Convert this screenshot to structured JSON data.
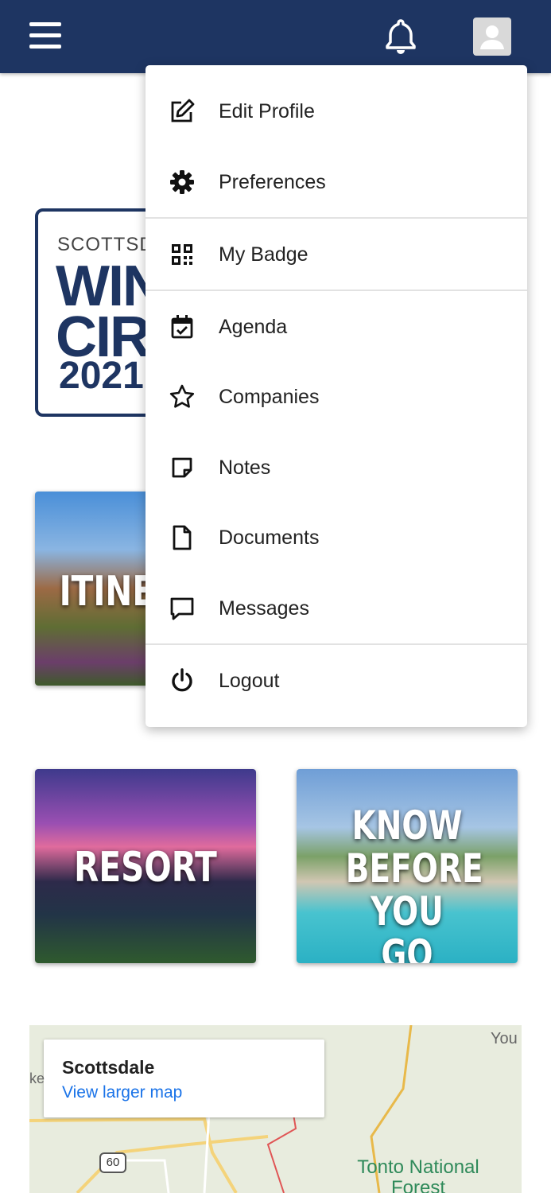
{
  "header": {
    "menu_icon": "hamburger-menu-icon",
    "notifications_icon": "bell-icon",
    "profile_icon": "user-avatar-icon"
  },
  "logo": {
    "small": "SCOTTSDALE",
    "line1": "WINTER",
    "line2": "CIRCLE",
    "year": "2021"
  },
  "tiles": [
    {
      "title": "ITINERARY"
    },
    {
      "title": "RESORT"
    },
    {
      "title": "KNOW BEFORE YOU GO"
    }
  ],
  "user_menu": {
    "items": [
      {
        "label": "Edit Profile",
        "icon": "edit-icon"
      },
      {
        "label": "Preferences",
        "icon": "gear-icon"
      },
      {
        "label": "My Badge",
        "icon": "qr-code-icon"
      },
      {
        "label": "Agenda",
        "icon": "calendar-check-icon"
      },
      {
        "label": "Companies",
        "icon": "star-icon"
      },
      {
        "label": "Notes",
        "icon": "note-icon"
      },
      {
        "label": "Documents",
        "icon": "document-icon"
      },
      {
        "label": "Messages",
        "icon": "message-icon"
      },
      {
        "label": "Logout",
        "icon": "power-icon"
      }
    ]
  },
  "map": {
    "place": "Scottsdale",
    "link": "View larger map",
    "label_forest": "Tonto National Forest",
    "label_you": "You",
    "label_ke": "ke",
    "route_shield": "60"
  },
  "colors": {
    "header_bg": "#1e3562",
    "link": "#1a73e8",
    "map_label": "#2f8a5a"
  }
}
